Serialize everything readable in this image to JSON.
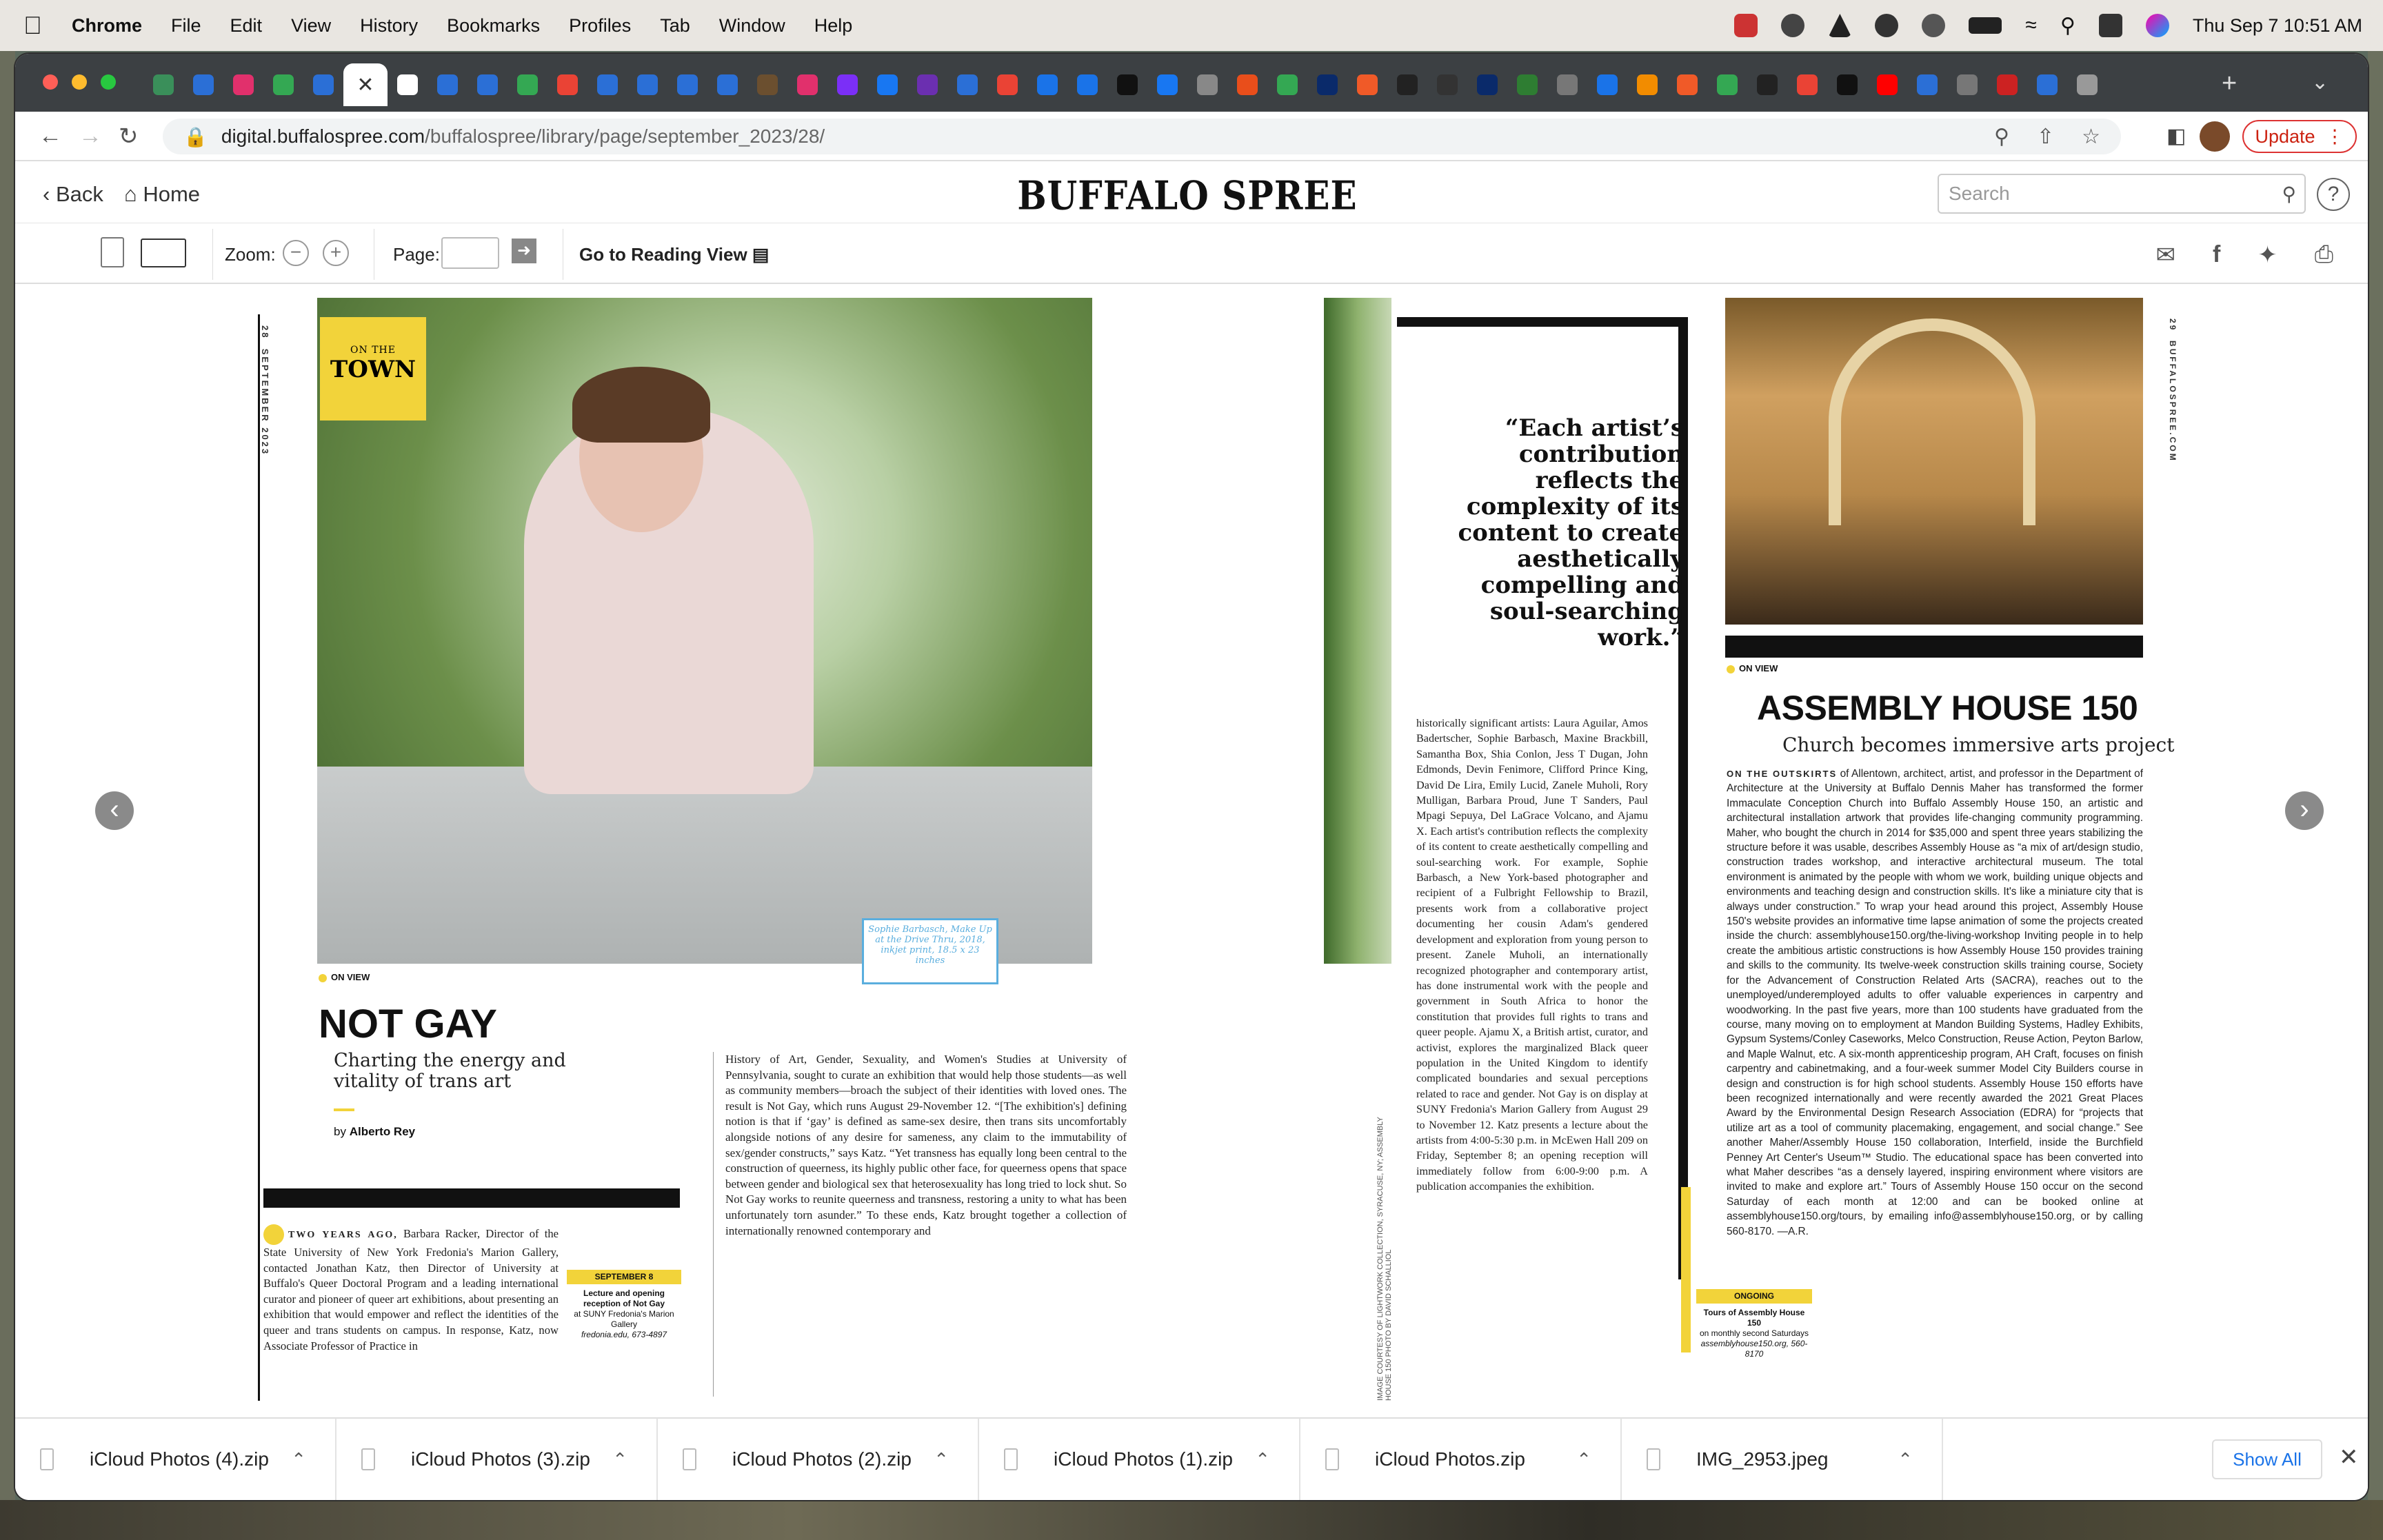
{
  "menubar": {
    "app": "Chrome",
    "items": [
      "File",
      "Edit",
      "View",
      "History",
      "Bookmarks",
      "Profiles",
      "Tab",
      "Window",
      "Help"
    ],
    "datetime": "Thu Sep 7  10:51 AM"
  },
  "browser": {
    "url_domain": "digital.buffalospree.com",
    "url_path": "/buffalospree/library/page/september_2023/28/",
    "update_label": "Update",
    "tab_favicon_colors": [
      "#3a8f5a",
      "#2b6fd6",
      "#e1306c",
      "#34a853",
      "#2b6fd6",
      "#2b6fd6",
      "#ffffff",
      "#2b6fd6",
      "#2b6fd6",
      "#34a853",
      "#ea4335",
      "#2b6fd6",
      "#2b6fd6",
      "#2b6fd6",
      "#2b6fd6",
      "#6b4f2f",
      "#e1306c",
      "#7b2ff7",
      "#1877f2",
      "#6b2fb0",
      "#2b6fd6",
      "#ea4335",
      "#1a73e8",
      "#1a73e8",
      "#111111",
      "#1877f2",
      "#888888",
      "#e94e1b",
      "#34a853",
      "#0a2a6a",
      "#f05a28",
      "#222222",
      "#333333",
      "#0a2a6a",
      "#2e7d32",
      "#777777",
      "#1a73e8",
      "#f28c00",
      "#f05a28",
      "#34a853",
      "#222222",
      "#ea4335",
      "#111111",
      "#ff0000",
      "#2b6fd6",
      "#777777",
      "#cc2222",
      "#2b6fd6",
      "#999999"
    ]
  },
  "viewer": {
    "back": "Back",
    "home": "Home",
    "logo": "BUFFALO SPREE",
    "search_placeholder": "Search",
    "zoom_label": "Zoom:",
    "page_label": "Page:",
    "reading_view": "Go to Reading View"
  },
  "left_page": {
    "folio_num": "28",
    "folio_text": "SEPTEMBER 2023",
    "section_small": "ON THE",
    "section_big": "TOWN",
    "photo_caption": "Sophie Barbasch, Make Up at the Drive Thru, 2018, inkjet print, 18.5 x 23 inches",
    "onview": "ON VIEW",
    "headline": "NOT GAY",
    "dek": "Charting the energy and vitality of trans art",
    "byline_prefix": "by",
    "byline_name": "Alberto Rey",
    "lead_caps": "TWO YEARS AGO,",
    "col1": "Barbara Racker, Director of the State University of New York Fredonia's Marion Gallery, contacted Jonathan Katz, then Director of University at Buffalo's Queer Doctoral Program and a leading international curator and pioneer of queer art exhibitions, about presenting an exhibition that would empower and reflect the identities of the queer and trans students on campus. In response, Katz, now Associate Professor of Practice in",
    "sidebar_tag": "SEPTEMBER 8",
    "sidebar_title": "Lecture and opening reception of Not Gay",
    "sidebar_place": "at SUNY Fredonia's Marion Gallery",
    "sidebar_contact": "fredonia.edu, 673-4897",
    "col2": "History of Art, Gender, Sexuality, and Women's Studies at University of Pennsylvania, sought to curate an exhibition that would help those students—as well as community members—broach the subject of their identities with loved ones. The result is Not Gay, which runs August 29-November 12. “[The exhibition's] defining notion is that if ‘gay’ is defined as same-sex desire, then trans sits uncomfortably alongside notions of any desire for sameness, any claim to the immutability of sex/gender constructs,” says Katz. “Yet transness has equally long been central to the construction of queerness, its highly public other face, for queerness opens that space between gender and biological sex that heterosexuality has long tried to lock shut. So Not Gay works to reunite queerness and transness, restoring a unity to what has been unfortunately torn asunder.” To these ends, Katz brought together a collection of internationally renowned contemporary and"
  },
  "right_page": {
    "quote": "“Each artist’s contribution reflects the complexity of its content to create aesthetically compelling and soul-searching work.”",
    "photo_credit": "IMAGE COURTESY OF LIGHTWORK COLLECTION, SYRACUSE, NY; ASSEMBLY HOUSE 150 PHOTO BY DAVID SCHALLIOL",
    "col3": "historically significant artists: Laura Aguilar, Amos Badertscher, Sophie Barbasch, Maxine Brackbill, Samantha Box, Shia Conlon, Jess T Dugan, John Edmonds, Devin Fenimore, Clifford Prince King, David De Lira, Emily Lucid, Zanele Muholi, Rory Mulligan, Barbara Proud, June T Sanders, Paul Mpagi Sepuya, Del LaGrace Volcano, and Ajamu X. Each artist's contribution reflects the complexity of its content to create aesthetically compelling and soul-searching work. For example, Sophie Barbasch, a New York-based photographer and recipient of a Fulbright Fellowship to Brazil, presents work from a collaborative project documenting her cousin Adam's gendered development and exploration from young person to present. Zanele Muholi, an internationally recognized photographer and contemporary artist, has done instrumental work with the people and government in South Africa to honor the constitution that provides full rights to trans and queer people. Ajamu X, a British artist, curator, and activist, explores the marginalized Black queer population in the United Kingdom to identify complicated boundaries and sexual perceptions related to race and gender. Not Gay is on display at SUNY Fredonia's Marion Gallery from August 29 to November 12. Katz presents a lecture about the artists from 4:00-5:30 p.m. in McEwen Hall 209 on Friday, September 8; an opening reception will immediately follow from 6:00-9:00 p.m. A publication accompanies the exhibition.",
    "side_tag": "ONGOING",
    "side_title": "Tours of Assembly House 150",
    "side_sub": "on monthly second Saturdays",
    "side_contact": "assemblyhouse150.org, 560-8170",
    "folio_text": "BUFFALOSPREE.COM",
    "folio_num": "29",
    "onview": "ON VIEW",
    "headline": "ASSEMBLY HOUSE 150",
    "dek": "Church becomes immersive arts project",
    "lead_caps": "ON THE OUTSKIRTS",
    "col4": "of Allentown, architect, artist, and professor in the Department of Architecture at the University at Buffalo Dennis Maher has transformed the former Immaculate Conception Church into Buffalo Assembly House 150, an artistic and architectural installation artwork that provides life-changing community programming. Maher, who bought the church in 2014 for $35,000 and spent three years stabilizing the structure before it was usable, describes Assembly House as “a mix of art/design studio, construction trades workshop, and interactive architectural museum. The total environment is animated by the people with whom we work, building unique objects and environments and teaching design and construction skills. It's like a miniature city that is always under construction.” To wrap your head around this project, Assembly House 150's website provides an informative time lapse animation of some the projects created inside the church: assemblyhouse150.org/the-living-workshop Inviting people in to help create the ambitious artistic constructions is how Assembly House 150 provides training and skills to the community. Its twelve-week construction skills training course, Society for the Advancement of Construction Related Arts (SACRA), reaches out to the unemployed/underemployed adults to offer valuable experiences in carpentry and woodworking. In the past five years, more than 100 students have graduated from the course, many moving on to employment at Mandon Building Systems, Hadley Exhibits, Gypsum Systems/Conley Caseworks, Melco Construction, Reuse Action, Peyton Barlow, and Maple Walnut, etc. A six-month apprenticeship program, AH Craft, focuses on finish carpentry and cabinetmaking, and a four-week summer Model City Builders course in design and construction is for high school students. Assembly House 150 efforts have been recognized internationally and were recently awarded the 2021 Great Places Award by the Environmental Design Research Association (EDRA) for “projects that utilize art as a tool of community placemaking, engagement, and social change.” See another Maher/Assembly House 150 collaboration, Interfield, inside the Burchfield Penney Art Center's Useum™ Studio. The educational space has been converted into what Maher describes “as a densely layered, inspiring environment where visitors are invited to make and explore art.” Tours of Assembly House 150 occur on the second Saturday of each month at 12:00 and can be booked online at assemblyhouse150.org/tours, by emailing info@assemblyhouse150.org, or by calling 560-8170. —A.R."
  },
  "downloads": {
    "items": [
      "iCloud Photos (4).zip",
      "iCloud Photos (3).zip",
      "iCloud Photos (2).zip",
      "iCloud Photos (1).zip",
      "iCloud Photos.zip",
      "IMG_2953.jpeg"
    ],
    "show_all": "Show All"
  }
}
